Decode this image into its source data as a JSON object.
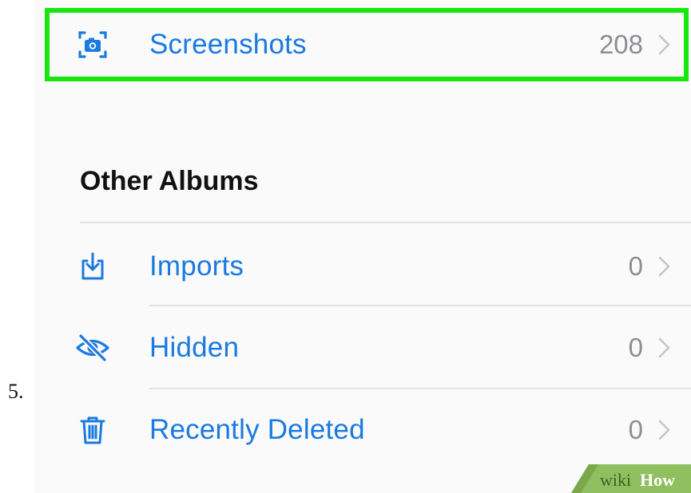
{
  "step_number": "5.",
  "highlighted_row": {
    "label": "Screenshots",
    "count": "208",
    "icon": "screenshot-icon"
  },
  "section": {
    "title": "Other Albums",
    "items": [
      {
        "label": "Imports",
        "count": "0",
        "icon": "import-icon"
      },
      {
        "label": "Hidden",
        "count": "0",
        "icon": "hidden-eye-icon"
      },
      {
        "label": "Recently Deleted",
        "count": "0",
        "icon": "trash-icon"
      }
    ]
  },
  "watermark": {
    "text_plain": "wiki",
    "text_bold": "How"
  },
  "colors": {
    "accent": "#1a7ae0",
    "count_gray": "#8e8e93",
    "highlight_green": "#17e70f",
    "watermark_green": "#8fbf5e"
  }
}
